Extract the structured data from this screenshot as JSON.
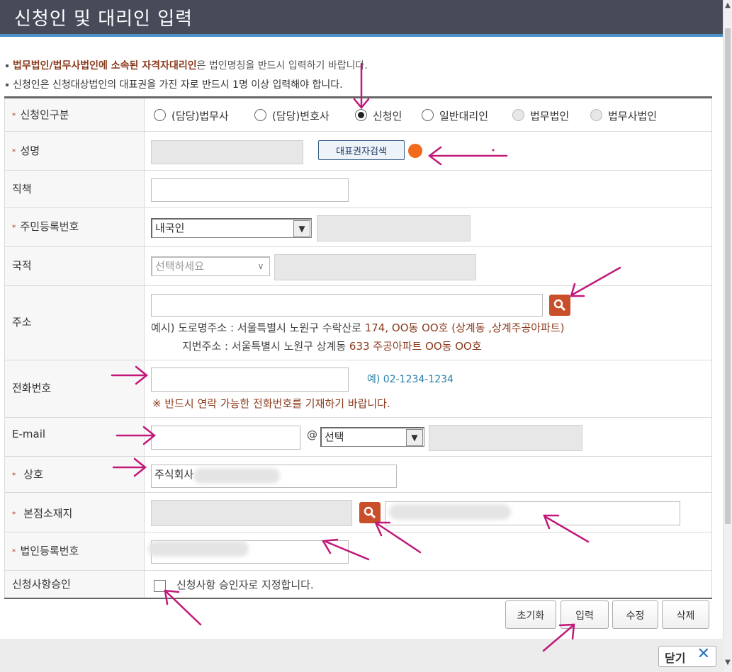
{
  "window": {
    "title": "신청인 및 대리인 입력"
  },
  "notices": [
    {
      "highlight": "법무법인/법무사법인에 소속된 자격자대리인",
      "rest": "은 법인명칭을 반드시 입력하기 바랍니다."
    },
    {
      "text": "신청인은 신청대상법인의 대표권을 가진 자로 반드시 1명 이상 입력해야 합니다."
    }
  ],
  "form": {
    "applicant_type": {
      "label": "신청인구분",
      "options": [
        {
          "label": "(담당)법무사",
          "state": "off"
        },
        {
          "label": "(담당)변호사",
          "state": "off"
        },
        {
          "label": "신청인",
          "state": "on"
        },
        {
          "label": "일반대리인",
          "state": "off"
        },
        {
          "label": "법무법인",
          "state": "disabled"
        },
        {
          "label": "법무사법인",
          "state": "disabled"
        }
      ]
    },
    "name": {
      "label": "성명",
      "value": "",
      "search_button": "대표권자검색"
    },
    "position": {
      "label": "직책",
      "value": ""
    },
    "resident_no": {
      "label": "주민등록번호",
      "select_value": "내국인",
      "value": ""
    },
    "nationality": {
      "label": "국적",
      "select_placeholder": "선택하세요",
      "value": ""
    },
    "address": {
      "label": "주소",
      "value": "",
      "example_prefix": "예시) 도로명주소 : ",
      "example_road_a": "서울특별시 노원구 수락산로 ",
      "example_road_b": "174, OO동 OO호",
      "example_road_c": " (상계동 ,상계주공아파트)",
      "example_lot_prefix": "지번주소 : ",
      "example_lot_a": "서울특별시 노원구 상계동 ",
      "example_lot_b": "633 주공아파트 OO동 OO호"
    },
    "phone": {
      "label": "전화번호",
      "value": "",
      "example": "예) 02-1234-1234",
      "note": "※ 반드시 연락 가능한 전화번호를 기재하기 바랍니다."
    },
    "email": {
      "label": "E-mail",
      "local": "",
      "at": "@",
      "domain_select": "선택",
      "domain": ""
    },
    "company": {
      "label": "상호",
      "value": "주식회사"
    },
    "headoffice": {
      "label": "본점소재지",
      "value": ""
    },
    "corp_reg_no": {
      "label": "법인등록번호",
      "value": ""
    },
    "approval": {
      "label": "신청사항승인",
      "checkbox_label": "신청사항 승인자로 지정합니다."
    }
  },
  "buttons": {
    "reset": "초기화",
    "submit": "입력",
    "edit": "수정",
    "delete": "삭제"
  },
  "footer": {
    "close": "닫기"
  },
  "colors": {
    "titlebar": "#474b59",
    "accent_blue": "#4a90c8",
    "required_star": "#c0392b",
    "annotation_arrow": "#c2187a",
    "search_orange": "#c94f2b",
    "status_dot": "#f26b1d"
  }
}
